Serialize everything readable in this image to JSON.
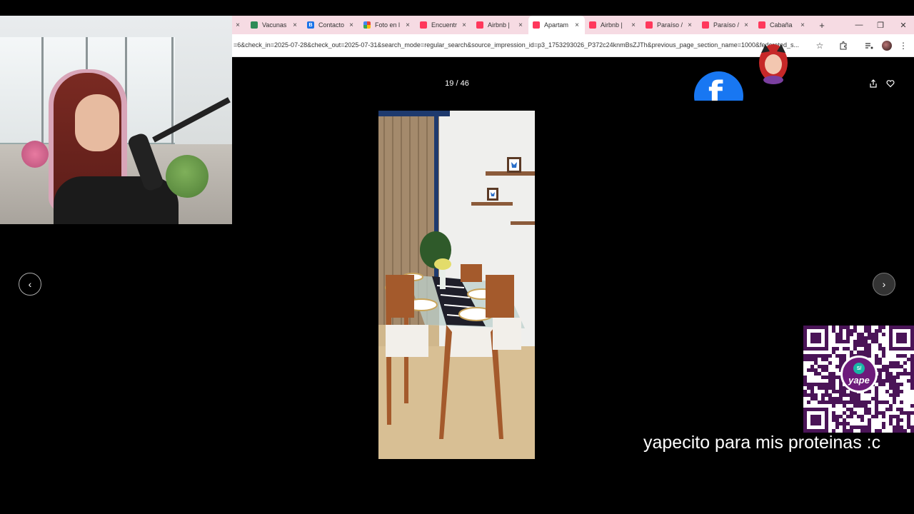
{
  "browser": {
    "tabs": [
      {
        "label": "Vacunas",
        "favicon": "green",
        "active": false
      },
      {
        "label": "Contacto",
        "favicon": "b",
        "active": false
      },
      {
        "label": "Foto en l",
        "favicon": "photos",
        "active": false
      },
      {
        "label": "Encuentr",
        "favicon": "airbnb",
        "active": false
      },
      {
        "label": "Airbnb |",
        "favicon": "airbnb",
        "active": false
      },
      {
        "label": "Apartam",
        "favicon": "airbnb",
        "active": true
      },
      {
        "label": "Airbnb |",
        "favicon": "airbnb",
        "active": false
      },
      {
        "label": "Paraíso /",
        "favicon": "airbnb",
        "active": false
      },
      {
        "label": "Paraíso /",
        "favicon": "airbnb",
        "active": false
      },
      {
        "label": "Cabaña",
        "favicon": "airbnb",
        "active": false
      }
    ],
    "close_glyph": "×",
    "new_tab_glyph": "+",
    "url": "=6&check_in=2025-07-28&check_out=2025-07-31&search_mode=regular_search&source_impression_id=p3_1753293026_P372c24knmBsZJTh&previous_page_section_name=1000&federated_s..."
  },
  "viewer": {
    "counter": "19 / 46",
    "prev_glyph": "‹",
    "next_glyph": "›"
  },
  "overlay": {
    "qr_brand": "yape",
    "qr_coin": "S/",
    "caption": "yapecito para mis proteinas :c"
  },
  "colors": {
    "tabbar": "#f6dbe3",
    "airbnb": "#ff385c",
    "facebook": "#1877f2",
    "yape": "#6d1b7b"
  }
}
